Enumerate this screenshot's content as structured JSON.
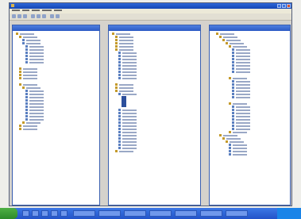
{
  "window": {
    "title": "",
    "accent": "#2e67d9"
  },
  "panels": [
    {
      "title": ""
    },
    {
      "title": ""
    },
    {
      "title": ""
    }
  ],
  "taskbar": {
    "start_label": "",
    "start_color": "#2c8a2a",
    "clock": ""
  },
  "colors": {
    "desktop": "#eeeeea",
    "panel_border": "#3a5fb0",
    "highlight": "#2c4f9c"
  }
}
